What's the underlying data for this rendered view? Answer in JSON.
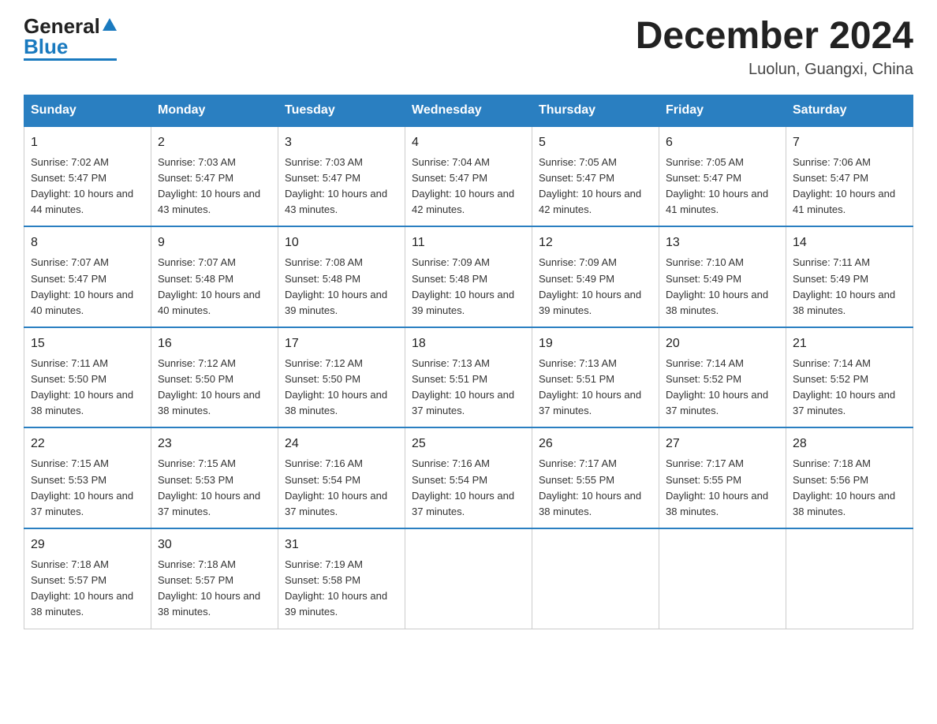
{
  "header": {
    "logo": {
      "general": "General",
      "blue": "Blue",
      "triangle": "▶"
    },
    "title": "December 2024",
    "location": "Luolun, Guangxi, China"
  },
  "calendar": {
    "days_of_week": [
      "Sunday",
      "Monday",
      "Tuesday",
      "Wednesday",
      "Thursday",
      "Friday",
      "Saturday"
    ],
    "weeks": [
      [
        {
          "day": "1",
          "sunrise": "7:02 AM",
          "sunset": "5:47 PM",
          "daylight": "10 hours and 44 minutes."
        },
        {
          "day": "2",
          "sunrise": "7:03 AM",
          "sunset": "5:47 PM",
          "daylight": "10 hours and 43 minutes."
        },
        {
          "day": "3",
          "sunrise": "7:03 AM",
          "sunset": "5:47 PM",
          "daylight": "10 hours and 43 minutes."
        },
        {
          "day": "4",
          "sunrise": "7:04 AM",
          "sunset": "5:47 PM",
          "daylight": "10 hours and 42 minutes."
        },
        {
          "day": "5",
          "sunrise": "7:05 AM",
          "sunset": "5:47 PM",
          "daylight": "10 hours and 42 minutes."
        },
        {
          "day": "6",
          "sunrise": "7:05 AM",
          "sunset": "5:47 PM",
          "daylight": "10 hours and 41 minutes."
        },
        {
          "day": "7",
          "sunrise": "7:06 AM",
          "sunset": "5:47 PM",
          "daylight": "10 hours and 41 minutes."
        }
      ],
      [
        {
          "day": "8",
          "sunrise": "7:07 AM",
          "sunset": "5:47 PM",
          "daylight": "10 hours and 40 minutes."
        },
        {
          "day": "9",
          "sunrise": "7:07 AM",
          "sunset": "5:48 PM",
          "daylight": "10 hours and 40 minutes."
        },
        {
          "day": "10",
          "sunrise": "7:08 AM",
          "sunset": "5:48 PM",
          "daylight": "10 hours and 39 minutes."
        },
        {
          "day": "11",
          "sunrise": "7:09 AM",
          "sunset": "5:48 PM",
          "daylight": "10 hours and 39 minutes."
        },
        {
          "day": "12",
          "sunrise": "7:09 AM",
          "sunset": "5:49 PM",
          "daylight": "10 hours and 39 minutes."
        },
        {
          "day": "13",
          "sunrise": "7:10 AM",
          "sunset": "5:49 PM",
          "daylight": "10 hours and 38 minutes."
        },
        {
          "day": "14",
          "sunrise": "7:11 AM",
          "sunset": "5:49 PM",
          "daylight": "10 hours and 38 minutes."
        }
      ],
      [
        {
          "day": "15",
          "sunrise": "7:11 AM",
          "sunset": "5:50 PM",
          "daylight": "10 hours and 38 minutes."
        },
        {
          "day": "16",
          "sunrise": "7:12 AM",
          "sunset": "5:50 PM",
          "daylight": "10 hours and 38 minutes."
        },
        {
          "day": "17",
          "sunrise": "7:12 AM",
          "sunset": "5:50 PM",
          "daylight": "10 hours and 38 minutes."
        },
        {
          "day": "18",
          "sunrise": "7:13 AM",
          "sunset": "5:51 PM",
          "daylight": "10 hours and 37 minutes."
        },
        {
          "day": "19",
          "sunrise": "7:13 AM",
          "sunset": "5:51 PM",
          "daylight": "10 hours and 37 minutes."
        },
        {
          "day": "20",
          "sunrise": "7:14 AM",
          "sunset": "5:52 PM",
          "daylight": "10 hours and 37 minutes."
        },
        {
          "day": "21",
          "sunrise": "7:14 AM",
          "sunset": "5:52 PM",
          "daylight": "10 hours and 37 minutes."
        }
      ],
      [
        {
          "day": "22",
          "sunrise": "7:15 AM",
          "sunset": "5:53 PM",
          "daylight": "10 hours and 37 minutes."
        },
        {
          "day": "23",
          "sunrise": "7:15 AM",
          "sunset": "5:53 PM",
          "daylight": "10 hours and 37 minutes."
        },
        {
          "day": "24",
          "sunrise": "7:16 AM",
          "sunset": "5:54 PM",
          "daylight": "10 hours and 37 minutes."
        },
        {
          "day": "25",
          "sunrise": "7:16 AM",
          "sunset": "5:54 PM",
          "daylight": "10 hours and 37 minutes."
        },
        {
          "day": "26",
          "sunrise": "7:17 AM",
          "sunset": "5:55 PM",
          "daylight": "10 hours and 38 minutes."
        },
        {
          "day": "27",
          "sunrise": "7:17 AM",
          "sunset": "5:55 PM",
          "daylight": "10 hours and 38 minutes."
        },
        {
          "day": "28",
          "sunrise": "7:18 AM",
          "sunset": "5:56 PM",
          "daylight": "10 hours and 38 minutes."
        }
      ],
      [
        {
          "day": "29",
          "sunrise": "7:18 AM",
          "sunset": "5:57 PM",
          "daylight": "10 hours and 38 minutes."
        },
        {
          "day": "30",
          "sunrise": "7:18 AM",
          "sunset": "5:57 PM",
          "daylight": "10 hours and 38 minutes."
        },
        {
          "day": "31",
          "sunrise": "7:19 AM",
          "sunset": "5:58 PM",
          "daylight": "10 hours and 39 minutes."
        },
        null,
        null,
        null,
        null
      ]
    ]
  }
}
